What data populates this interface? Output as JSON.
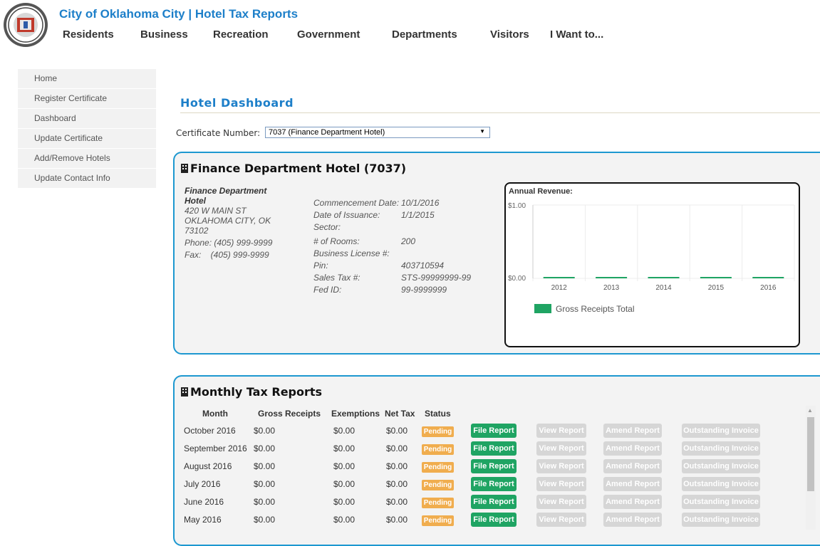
{
  "header": {
    "title": "City of Oklahoma City | Hotel Tax Reports",
    "nav": [
      "Residents",
      "Business",
      "Recreation",
      "Government",
      "Departments",
      "Visitors",
      "I Want to..."
    ]
  },
  "sidebar": {
    "items": [
      "Home",
      "Register Certificate",
      "Dashboard",
      "Update Certificate",
      "Add/Remove Hotels",
      "Update Contact Info"
    ]
  },
  "dashboard": {
    "title": "Hotel Dashboard",
    "certificate_label": "Certificate Number:",
    "certificate_selected": "7037 (Finance Department Hotel)"
  },
  "hotel": {
    "panel_title": "Finance Department Hotel (7037)",
    "name": "Finance Department Hotel",
    "address1": "420 W MAIN ST",
    "address2": "OKLAHOMA CITY, OK 73102",
    "phone": "Phone: (405) 999-9999",
    "fax": "Fax:    (405) 999-9999",
    "details": [
      {
        "label": "Commencement Date:",
        "value": "10/1/2016"
      },
      {
        "label": "Date of Issuance:",
        "value": "1/1/2015"
      },
      {
        "label": "Sector:",
        "value": ""
      },
      {
        "label": "# of Rooms:",
        "value": "200"
      },
      {
        "label": "Business License #:",
        "value": ""
      },
      {
        "label": "Pin:",
        "value": "403710594"
      },
      {
        "label": "Sales Tax #:",
        "value": "STS-99999999-99"
      },
      {
        "label": "Fed ID:",
        "value": "99-9999999"
      }
    ]
  },
  "chart_data": {
    "type": "bar",
    "title": "Annual Revenue:",
    "categories": [
      "2012",
      "2013",
      "2014",
      "2015",
      "2016"
    ],
    "series": [
      {
        "name": "Gross Receipts Total",
        "values": [
          0,
          0,
          0,
          0,
          0
        ],
        "color": "#1fa463"
      }
    ],
    "yticks": [
      "$1.00",
      "$0.00"
    ],
    "ylim": [
      0,
      1
    ],
    "grid": true,
    "legend": "bottom"
  },
  "reports": {
    "panel_title": "Monthly Tax Reports",
    "columns": [
      "Month",
      "Gross Receipts",
      "Exemptions",
      "Net Tax",
      "Status"
    ],
    "rows": [
      {
        "month": "October 2016",
        "gross": "$0.00",
        "exemptions": "$0.00",
        "net": "$0.00",
        "status": "Pending"
      },
      {
        "month": "September 2016",
        "gross": "$0.00",
        "exemptions": "$0.00",
        "net": "$0.00",
        "status": "Pending"
      },
      {
        "month": "August 2016",
        "gross": "$0.00",
        "exemptions": "$0.00",
        "net": "$0.00",
        "status": "Pending"
      },
      {
        "month": "July 2016",
        "gross": "$0.00",
        "exemptions": "$0.00",
        "net": "$0.00",
        "status": "Pending"
      },
      {
        "month": "June 2016",
        "gross": "$0.00",
        "exemptions": "$0.00",
        "net": "$0.00",
        "status": "Pending"
      },
      {
        "month": "May 2016",
        "gross": "$0.00",
        "exemptions": "$0.00",
        "net": "$0.00",
        "status": "Pending"
      }
    ],
    "buttons": {
      "file": "File Report",
      "view": "View Report",
      "amend": "Amend Report",
      "outstanding": "Outstanding Invoice"
    }
  },
  "colors": {
    "accent": "#1d7fc9",
    "panel_border": "#1d98d0",
    "success": "#1fa463",
    "warning": "#f0ad4e",
    "disabled": "#d6d6d6"
  }
}
